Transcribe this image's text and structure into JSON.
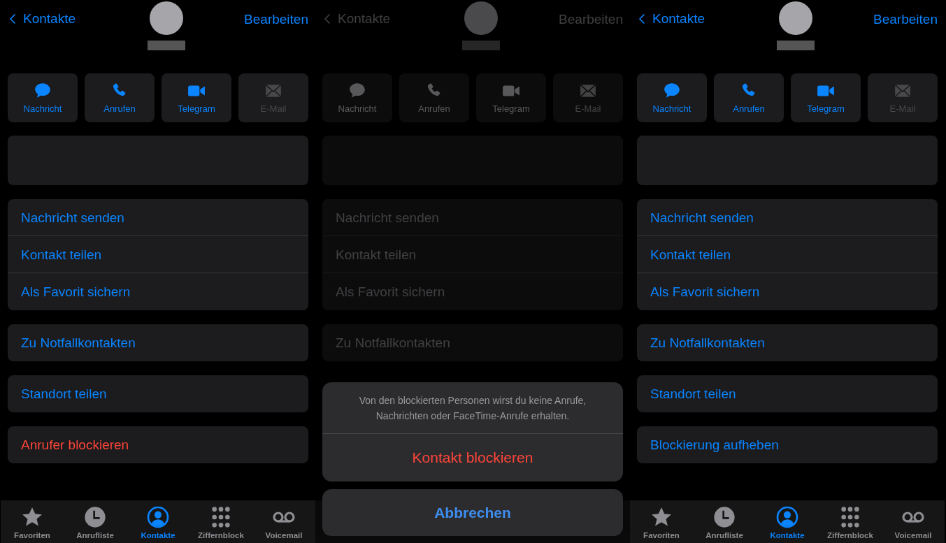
{
  "panels": [
    {
      "dimmed": false,
      "nav": {
        "back": "Kontakte",
        "edit": "Bearbeiten"
      },
      "actions": [
        {
          "label": "Nachricht",
          "disabled": false
        },
        {
          "label": "Anrufen",
          "disabled": false
        },
        {
          "label": "Telegram",
          "disabled": false
        },
        {
          "label": "E-Mail",
          "disabled": true
        }
      ],
      "groups": [
        [
          {
            "label": "Nachricht senden",
            "kind": "action"
          },
          {
            "label": "Kontakt teilen",
            "kind": "action"
          },
          {
            "label": "Als Favorit sichern",
            "kind": "action"
          }
        ],
        [
          {
            "label": "Zu Notfallkontakten",
            "kind": "action"
          }
        ],
        [
          {
            "label": "Standort teilen",
            "kind": "action"
          }
        ],
        [
          {
            "label": "Anrufer blockieren",
            "kind": "destructive"
          }
        ]
      ],
      "tabs": [
        {
          "label": "Favoriten",
          "selected": false
        },
        {
          "label": "Anrufliste",
          "selected": false
        },
        {
          "label": "Kontakte",
          "selected": true
        },
        {
          "label": "Ziffernblock",
          "selected": false
        },
        {
          "label": "Voicemail",
          "selected": false
        }
      ]
    },
    {
      "dimmed": true,
      "nav": {
        "back": "Kontakte",
        "edit": "Bearbeiten"
      },
      "actions": [
        {
          "label": "Nachricht",
          "disabled": false
        },
        {
          "label": "Anrufen",
          "disabled": false
        },
        {
          "label": "Telegram",
          "disabled": false
        },
        {
          "label": "E-Mail",
          "disabled": true
        }
      ],
      "groups": [
        [
          {
            "label": "Nachricht senden",
            "kind": "action"
          },
          {
            "label": "Kontakt teilen",
            "kind": "action"
          },
          {
            "label": "Als Favorit sichern",
            "kind": "action"
          }
        ],
        [
          {
            "label": "Zu Notfallkontakten",
            "kind": "action"
          }
        ]
      ],
      "sheet": {
        "message": "Von den blockierten Personen wirst du keine Anrufe, Nachrichten oder FaceTime-Anrufe erhalten.",
        "confirm": "Kontakt blockieren",
        "cancel": "Abbrechen"
      }
    },
    {
      "dimmed": false,
      "nav": {
        "back": "Kontakte",
        "edit": "Bearbeiten"
      },
      "actions": [
        {
          "label": "Nachricht",
          "disabled": false
        },
        {
          "label": "Anrufen",
          "disabled": false
        },
        {
          "label": "Telegram",
          "disabled": false
        },
        {
          "label": "E-Mail",
          "disabled": true
        }
      ],
      "groups": [
        [
          {
            "label": "Nachricht senden",
            "kind": "action"
          },
          {
            "label": "Kontakt teilen",
            "kind": "action"
          },
          {
            "label": "Als Favorit sichern",
            "kind": "action"
          }
        ],
        [
          {
            "label": "Zu Notfallkontakten",
            "kind": "action"
          }
        ],
        [
          {
            "label": "Standort teilen",
            "kind": "action"
          }
        ],
        [
          {
            "label": "Blockierung aufheben",
            "kind": "action"
          }
        ]
      ],
      "tabs": [
        {
          "label": "Favoriten",
          "selected": false
        },
        {
          "label": "Anrufliste",
          "selected": false
        },
        {
          "label": "Kontakte",
          "selected": true
        },
        {
          "label": "Ziffernblock",
          "selected": false
        },
        {
          "label": "Voicemail",
          "selected": false
        }
      ]
    }
  ]
}
